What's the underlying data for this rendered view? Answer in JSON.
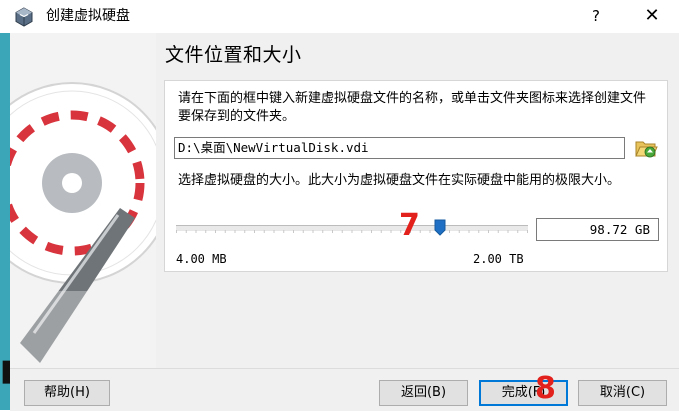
{
  "window": {
    "title": "创建虚拟硬盘",
    "help_glyph": "?",
    "close_glyph": "✕"
  },
  "page": {
    "title": "文件位置和大小",
    "location_description": "请在下面的框中键入新建虚拟硬盘文件的名称，或单击文件夹图标来选择创建文件要保存到的文件夹。",
    "file_path": "D:\\桌面\\NewVirtualDisk.vdi",
    "size_description": "选择虚拟硬盘的大小。此大小为虚拟硬盘文件在实际硬盘中能用的极限大小。",
    "size_value": "98.72 GB",
    "size_min_label": "4.00 MB",
    "size_max_label": "2.00 TB",
    "slider_position": 0.75
  },
  "annotations": {
    "step7": "7",
    "step8": "8"
  },
  "buttons": {
    "help": "帮助(H)",
    "back": "返回(B)",
    "finish": "完成(F)",
    "cancel": "取消(C)"
  },
  "colors": {
    "accent_strip": "#3aa6b8",
    "annotation_red": "#e3211c",
    "default_button_border": "#0078d7",
    "slider_thumb": "#1f6fc4"
  },
  "icons": {
    "app": "virtualbox-cube-icon",
    "folder": "folder-open-icon",
    "slider": "slider-thumb"
  }
}
